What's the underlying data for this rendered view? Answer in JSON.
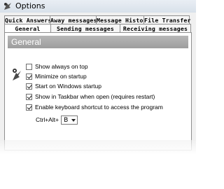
{
  "window": {
    "title": "Options"
  },
  "tabs_top": [
    {
      "label": "Quick Answers"
    },
    {
      "label": "Away messages"
    },
    {
      "label": "Message History"
    },
    {
      "label": "File Transfer"
    }
  ],
  "tabs_bottom": [
    {
      "label": "General",
      "active": true
    },
    {
      "label": "Sending messages"
    },
    {
      "label": "Receiving messages"
    }
  ],
  "section": {
    "title": "General"
  },
  "options": [
    {
      "label": "Show always on top",
      "checked": false
    },
    {
      "label": "Minimize on startup",
      "checked": true
    },
    {
      "label": "Start on Windows startup",
      "checked": true
    },
    {
      "label": "Show in Taskbar when open (requires restart)",
      "checked": true
    },
    {
      "label": "Enable keyboard shortcut to access the program",
      "checked": true
    }
  ],
  "shortcut": {
    "label": "Ctrl+Alt+",
    "value": "B"
  }
}
